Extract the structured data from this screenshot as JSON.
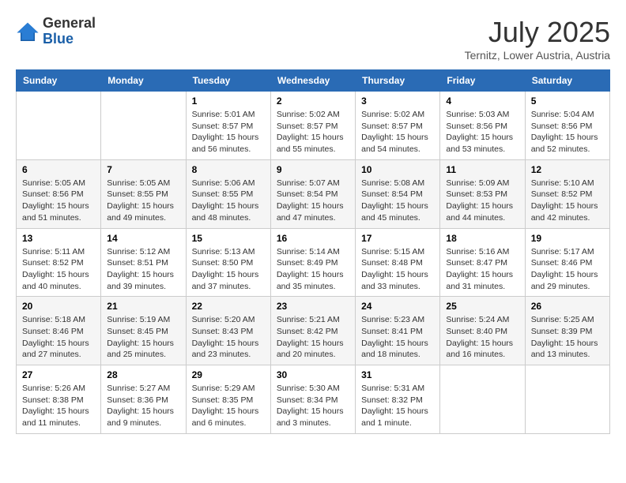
{
  "logo": {
    "general": "General",
    "blue": "Blue"
  },
  "header": {
    "month": "July 2025",
    "subtitle": "Ternitz, Lower Austria, Austria"
  },
  "weekdays": [
    "Sunday",
    "Monday",
    "Tuesday",
    "Wednesday",
    "Thursday",
    "Friday",
    "Saturday"
  ],
  "weeks": [
    [
      {
        "day": "",
        "sunrise": "",
        "sunset": "",
        "daylight": ""
      },
      {
        "day": "",
        "sunrise": "",
        "sunset": "",
        "daylight": ""
      },
      {
        "day": "1",
        "sunrise": "Sunrise: 5:01 AM",
        "sunset": "Sunset: 8:57 PM",
        "daylight": "Daylight: 15 hours and 56 minutes."
      },
      {
        "day": "2",
        "sunrise": "Sunrise: 5:02 AM",
        "sunset": "Sunset: 8:57 PM",
        "daylight": "Daylight: 15 hours and 55 minutes."
      },
      {
        "day": "3",
        "sunrise": "Sunrise: 5:02 AM",
        "sunset": "Sunset: 8:57 PM",
        "daylight": "Daylight: 15 hours and 54 minutes."
      },
      {
        "day": "4",
        "sunrise": "Sunrise: 5:03 AM",
        "sunset": "Sunset: 8:56 PM",
        "daylight": "Daylight: 15 hours and 53 minutes."
      },
      {
        "day": "5",
        "sunrise": "Sunrise: 5:04 AM",
        "sunset": "Sunset: 8:56 PM",
        "daylight": "Daylight: 15 hours and 52 minutes."
      }
    ],
    [
      {
        "day": "6",
        "sunrise": "Sunrise: 5:05 AM",
        "sunset": "Sunset: 8:56 PM",
        "daylight": "Daylight: 15 hours and 51 minutes."
      },
      {
        "day": "7",
        "sunrise": "Sunrise: 5:05 AM",
        "sunset": "Sunset: 8:55 PM",
        "daylight": "Daylight: 15 hours and 49 minutes."
      },
      {
        "day": "8",
        "sunrise": "Sunrise: 5:06 AM",
        "sunset": "Sunset: 8:55 PM",
        "daylight": "Daylight: 15 hours and 48 minutes."
      },
      {
        "day": "9",
        "sunrise": "Sunrise: 5:07 AM",
        "sunset": "Sunset: 8:54 PM",
        "daylight": "Daylight: 15 hours and 47 minutes."
      },
      {
        "day": "10",
        "sunrise": "Sunrise: 5:08 AM",
        "sunset": "Sunset: 8:54 PM",
        "daylight": "Daylight: 15 hours and 45 minutes."
      },
      {
        "day": "11",
        "sunrise": "Sunrise: 5:09 AM",
        "sunset": "Sunset: 8:53 PM",
        "daylight": "Daylight: 15 hours and 44 minutes."
      },
      {
        "day": "12",
        "sunrise": "Sunrise: 5:10 AM",
        "sunset": "Sunset: 8:52 PM",
        "daylight": "Daylight: 15 hours and 42 minutes."
      }
    ],
    [
      {
        "day": "13",
        "sunrise": "Sunrise: 5:11 AM",
        "sunset": "Sunset: 8:52 PM",
        "daylight": "Daylight: 15 hours and 40 minutes."
      },
      {
        "day": "14",
        "sunrise": "Sunrise: 5:12 AM",
        "sunset": "Sunset: 8:51 PM",
        "daylight": "Daylight: 15 hours and 39 minutes."
      },
      {
        "day": "15",
        "sunrise": "Sunrise: 5:13 AM",
        "sunset": "Sunset: 8:50 PM",
        "daylight": "Daylight: 15 hours and 37 minutes."
      },
      {
        "day": "16",
        "sunrise": "Sunrise: 5:14 AM",
        "sunset": "Sunset: 8:49 PM",
        "daylight": "Daylight: 15 hours and 35 minutes."
      },
      {
        "day": "17",
        "sunrise": "Sunrise: 5:15 AM",
        "sunset": "Sunset: 8:48 PM",
        "daylight": "Daylight: 15 hours and 33 minutes."
      },
      {
        "day": "18",
        "sunrise": "Sunrise: 5:16 AM",
        "sunset": "Sunset: 8:47 PM",
        "daylight": "Daylight: 15 hours and 31 minutes."
      },
      {
        "day": "19",
        "sunrise": "Sunrise: 5:17 AM",
        "sunset": "Sunset: 8:46 PM",
        "daylight": "Daylight: 15 hours and 29 minutes."
      }
    ],
    [
      {
        "day": "20",
        "sunrise": "Sunrise: 5:18 AM",
        "sunset": "Sunset: 8:46 PM",
        "daylight": "Daylight: 15 hours and 27 minutes."
      },
      {
        "day": "21",
        "sunrise": "Sunrise: 5:19 AM",
        "sunset": "Sunset: 8:45 PM",
        "daylight": "Daylight: 15 hours and 25 minutes."
      },
      {
        "day": "22",
        "sunrise": "Sunrise: 5:20 AM",
        "sunset": "Sunset: 8:43 PM",
        "daylight": "Daylight: 15 hours and 23 minutes."
      },
      {
        "day": "23",
        "sunrise": "Sunrise: 5:21 AM",
        "sunset": "Sunset: 8:42 PM",
        "daylight": "Daylight: 15 hours and 20 minutes."
      },
      {
        "day": "24",
        "sunrise": "Sunrise: 5:23 AM",
        "sunset": "Sunset: 8:41 PM",
        "daylight": "Daylight: 15 hours and 18 minutes."
      },
      {
        "day": "25",
        "sunrise": "Sunrise: 5:24 AM",
        "sunset": "Sunset: 8:40 PM",
        "daylight": "Daylight: 15 hours and 16 minutes."
      },
      {
        "day": "26",
        "sunrise": "Sunrise: 5:25 AM",
        "sunset": "Sunset: 8:39 PM",
        "daylight": "Daylight: 15 hours and 13 minutes."
      }
    ],
    [
      {
        "day": "27",
        "sunrise": "Sunrise: 5:26 AM",
        "sunset": "Sunset: 8:38 PM",
        "daylight": "Daylight: 15 hours and 11 minutes."
      },
      {
        "day": "28",
        "sunrise": "Sunrise: 5:27 AM",
        "sunset": "Sunset: 8:36 PM",
        "daylight": "Daylight: 15 hours and 9 minutes."
      },
      {
        "day": "29",
        "sunrise": "Sunrise: 5:29 AM",
        "sunset": "Sunset: 8:35 PM",
        "daylight": "Daylight: 15 hours and 6 minutes."
      },
      {
        "day": "30",
        "sunrise": "Sunrise: 5:30 AM",
        "sunset": "Sunset: 8:34 PM",
        "daylight": "Daylight: 15 hours and 3 minutes."
      },
      {
        "day": "31",
        "sunrise": "Sunrise: 5:31 AM",
        "sunset": "Sunset: 8:32 PM",
        "daylight": "Daylight: 15 hours and 1 minute."
      },
      {
        "day": "",
        "sunrise": "",
        "sunset": "",
        "daylight": ""
      },
      {
        "day": "",
        "sunrise": "",
        "sunset": "",
        "daylight": ""
      }
    ]
  ]
}
